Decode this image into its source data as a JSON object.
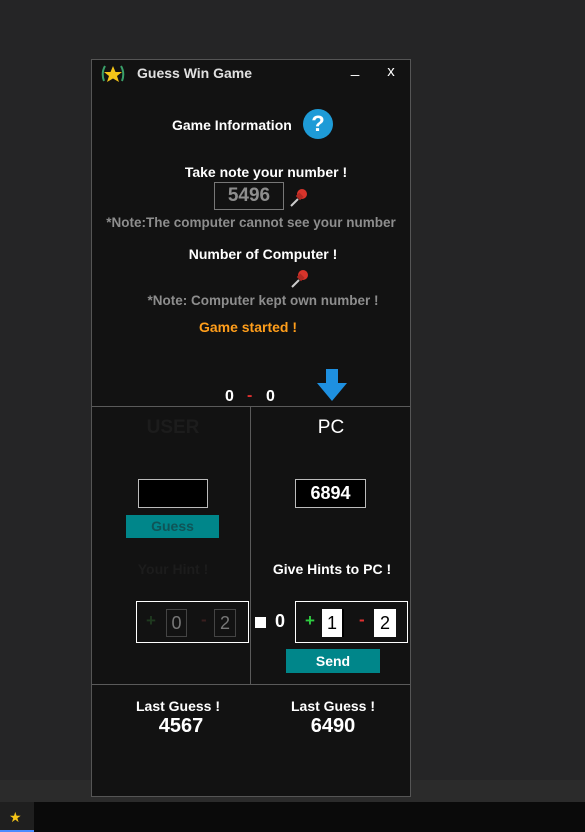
{
  "window": {
    "title": "Guess Win Game",
    "minimize": "_",
    "close": "x"
  },
  "info": {
    "heading": "Game Information",
    "help_glyph": "?"
  },
  "user_number": {
    "label": "Take note your number !",
    "value": "5496",
    "note": "*Note:The computer cannot see your number"
  },
  "computer_number": {
    "label": "Number of Computer !",
    "note": "*Note: Computer kept own number !"
  },
  "status": {
    "text": "Game started !",
    "color": "#ff9e1b"
  },
  "score": {
    "user": "0",
    "separator": "-",
    "pc": "0"
  },
  "user_panel": {
    "title": "USER",
    "guess_input": "",
    "guess_button": "Guess",
    "hint_label": "Your Hint !",
    "hint_plus_sign": "+",
    "hint_plus": "0",
    "hint_minus_sign": "-",
    "hint_minus": "2"
  },
  "pc_panel": {
    "title": "PC",
    "guess_value": "6894",
    "hint_label": "Give Hints to PC !",
    "zero_value": "0",
    "hint_plus_sign": "+",
    "hint_plus": "1",
    "hint_minus_sign": "-",
    "hint_minus": "2",
    "send_button": "Send"
  },
  "last_guess": {
    "user_label": "Last Guess !",
    "user_value": "4567",
    "pc_label": "Last Guess !",
    "pc_value": "6490"
  },
  "colors": {
    "accent_teal": "#00868a",
    "arrow_blue": "#1e90e0",
    "plus_green": "#2ecc40",
    "minus_red": "#e03030"
  }
}
